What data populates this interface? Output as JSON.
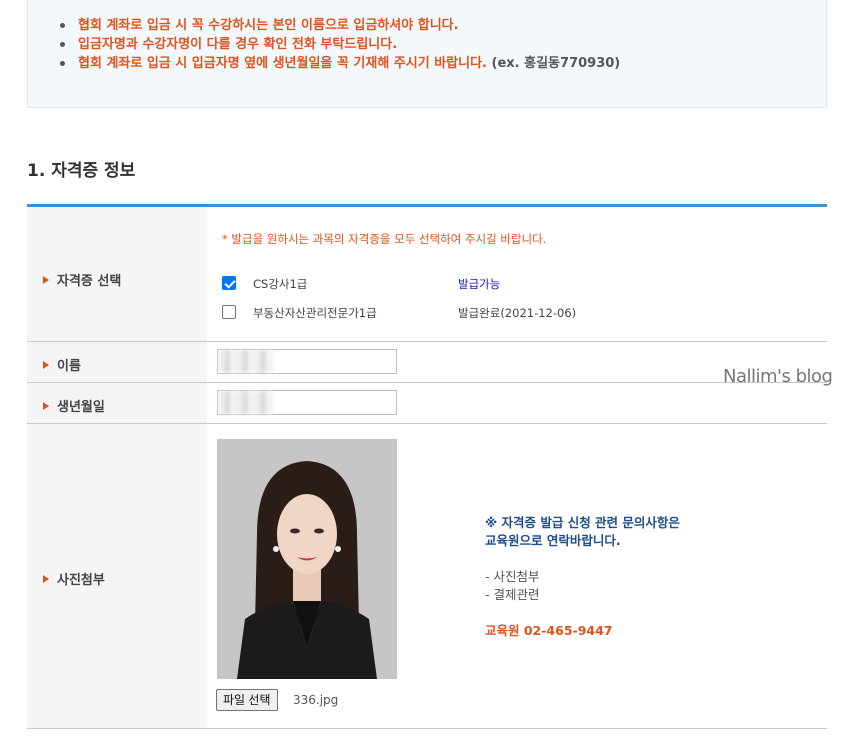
{
  "notice": {
    "items": [
      "협회 계좌로 입금 시 꼭 수강하시는 본인 이름으로 입금하셔야 합니다.",
      "입금자명과 수강자명이 다를 경우 확인 전화 부탁드립니다.",
      "협회 계좌로 입금 시 입금자명 옆에 생년월일을 꼭 기재해 주시기 바랍니다."
    ],
    "example": "(ex. 홍길동770930)"
  },
  "section_title": "1. 자격증 정보",
  "cert_row": {
    "label": "자격증 선택",
    "guide": "* 발급을 원하시는 과목의 자격증을 모두 선택하여 주시길 바랍니다.",
    "certificates": [
      {
        "name": "CS강사1급",
        "status": "발급가능",
        "checked": true
      },
      {
        "name": "부동산자산관리전문가1급",
        "status": "발급완료(2021-12-06)",
        "checked": false
      }
    ]
  },
  "name_row": {
    "label": "이름"
  },
  "birth_row": {
    "label": "생년월일"
  },
  "photo_row": {
    "label": "사진첨부",
    "file_button": "파일 선택",
    "file_name": "336.jpg",
    "contact_line1": "※ 자격증 발급 신청 관련 문의사항은",
    "contact_line2": "교육원으로 연락바랍니다.",
    "contact_item1": "- 사진첨부",
    "contact_item2": "- 결제관련",
    "contact_phone": "교육원 02-465-9447"
  },
  "watermark": "Nallim's blog",
  "colors": {
    "accent_blue": "#3b8fd6",
    "notice_orange": "#e0531c",
    "available_blue": "#1a1ab0"
  }
}
